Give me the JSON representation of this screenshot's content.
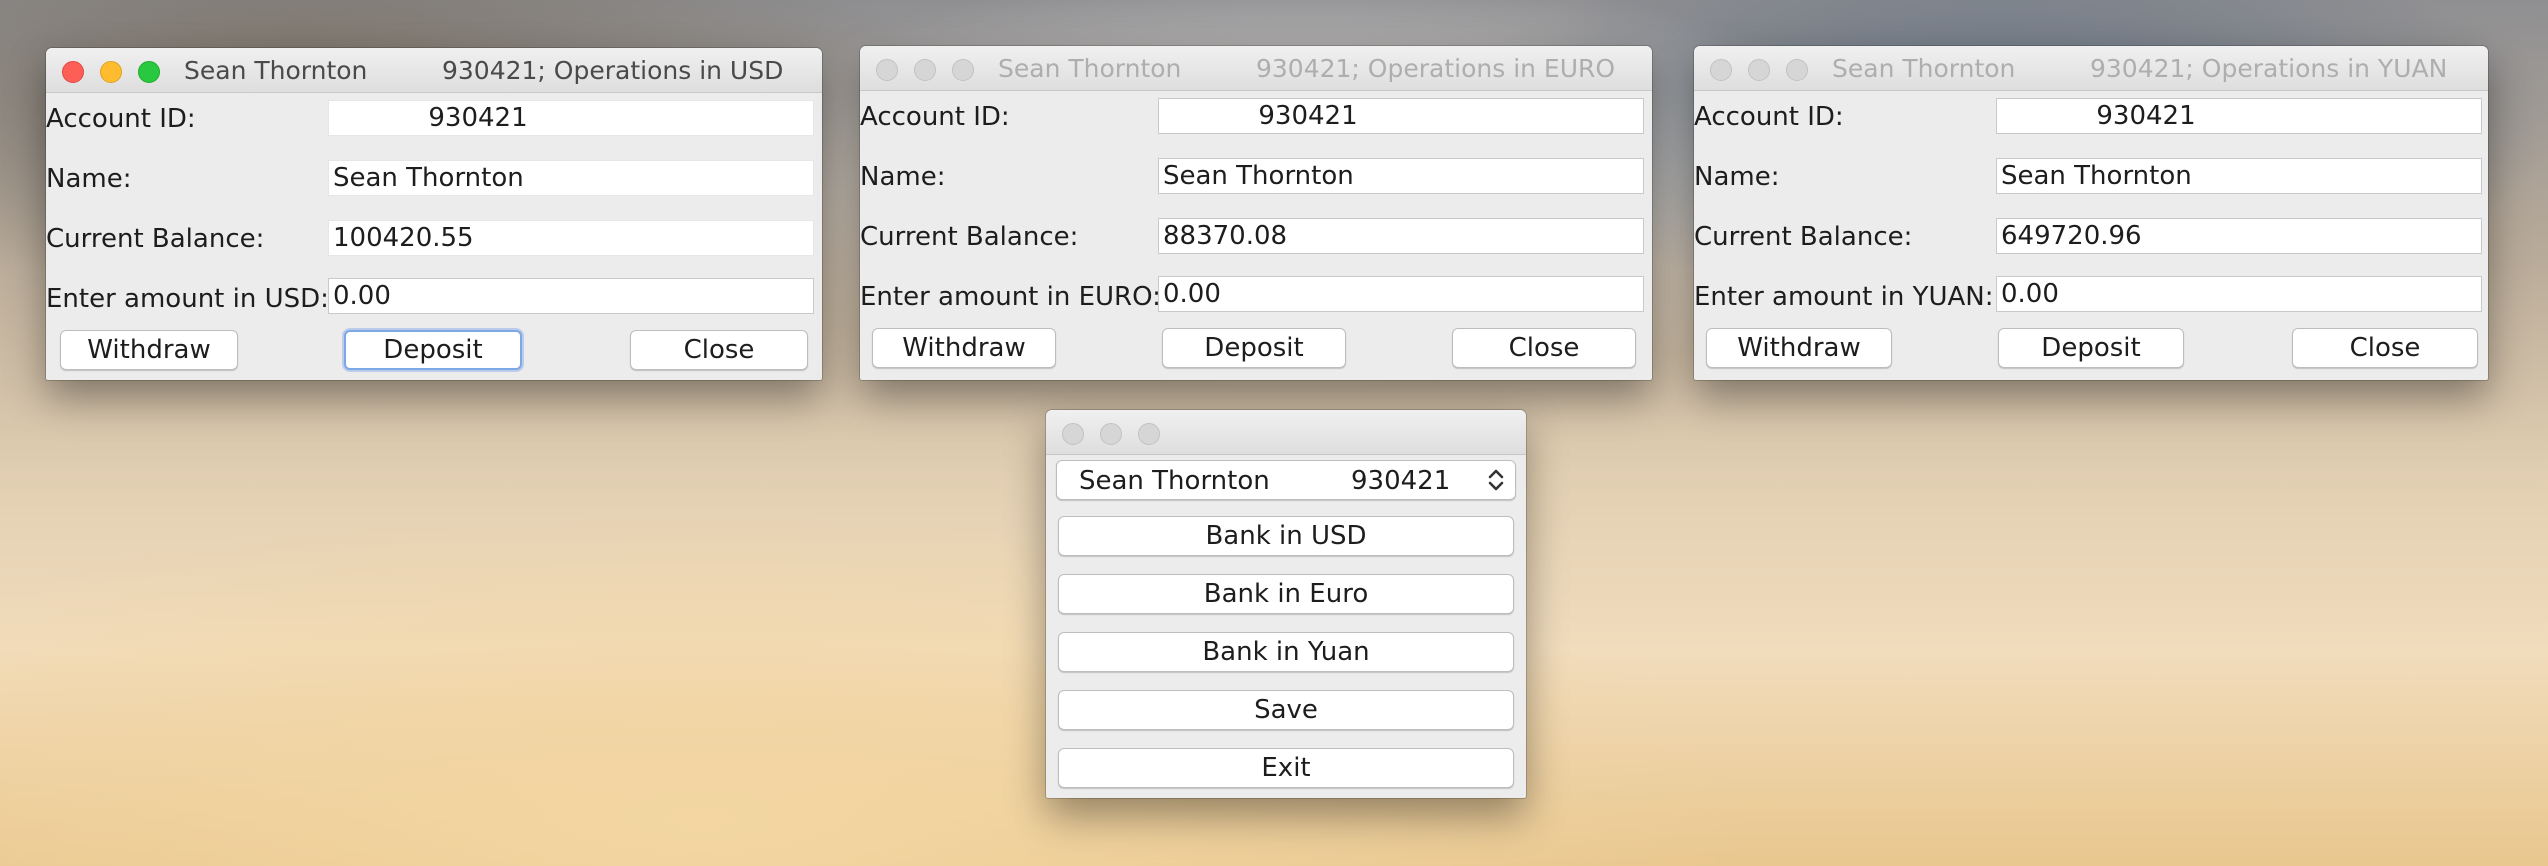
{
  "windows": {
    "usd": {
      "title_name": "Sean Thornton",
      "title_info": "930421; Operations in USD",
      "account_id_label": "Account ID:",
      "account_id_value": "930421",
      "name_label": "Name:",
      "name_value": "Sean Thornton",
      "balance_label": "Current Balance:",
      "balance_value": "100420.55",
      "amount_label": "Enter amount in USD:",
      "amount_value": "0.00",
      "withdraw_label": "Withdraw",
      "deposit_label": "Deposit",
      "close_label": "Close"
    },
    "euro": {
      "title_name": "Sean Thornton",
      "title_info": "930421; Operations in EURO",
      "account_id_label": "Account ID:",
      "account_id_value": "930421",
      "name_label": "Name:",
      "name_value": "Sean Thornton",
      "balance_label": "Current Balance:",
      "balance_value": "88370.08",
      "amount_label": "Enter amount in EURO:",
      "amount_value": "0.00",
      "withdraw_label": "Withdraw",
      "deposit_label": "Deposit",
      "close_label": "Close"
    },
    "yuan": {
      "title_name": "Sean Thornton",
      "title_info": "930421; Operations in YUAN",
      "account_id_label": "Account ID:",
      "account_id_value": "930421",
      "name_label": "Name:",
      "name_value": "Sean Thornton",
      "balance_label": "Current Balance:",
      "balance_value": "649720.96",
      "amount_label": "Enter amount in YUAN:",
      "amount_value": "0.00",
      "withdraw_label": "Withdraw",
      "deposit_label": "Deposit",
      "close_label": "Close"
    },
    "menu": {
      "account_select_name": "Sean Thornton",
      "account_select_id": "930421",
      "bank_usd_label": "Bank in USD",
      "bank_euro_label": "Bank in Euro",
      "bank_yuan_label": "Bank in Yuan",
      "save_label": "Save",
      "exit_label": "Exit"
    }
  },
  "icons": {
    "traffic_lights_active": [
      "close-icon",
      "minimize-icon",
      "zoom-icon"
    ],
    "select_arrows": "updown-chevron-icon"
  },
  "colors": {
    "window_bg": "#ececec",
    "focus_ring": "#7ea7e6",
    "close_light": "#fd5f57",
    "minimize_light": "#febc2e",
    "zoom_light": "#28c840"
  }
}
